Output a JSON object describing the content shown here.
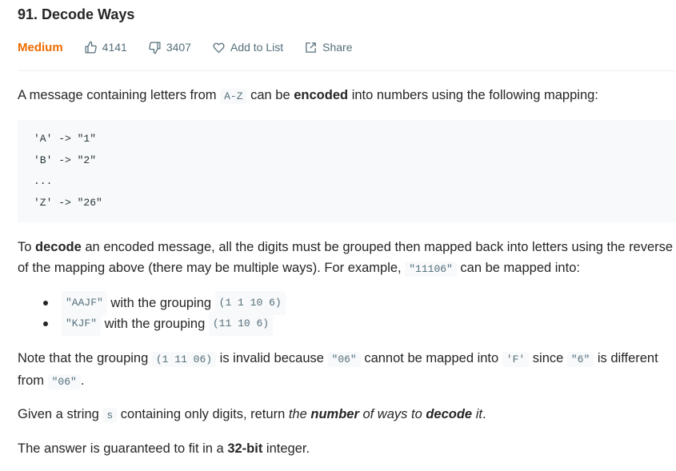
{
  "problem": {
    "title": "91. Decode Ways",
    "difficulty": "Medium",
    "likes": "4141",
    "dislikes": "3407",
    "add_to_list": "Add to List",
    "share": "Share"
  },
  "colors": {
    "difficulty": "#ef6c00",
    "meta": "#546e7a",
    "code_bg": "#f7f9fa"
  },
  "icons": [
    "thumbs-up-icon",
    "thumbs-down-icon",
    "heart-icon",
    "share-icon"
  ],
  "description": {
    "p1": {
      "a": "A message containing letters from ",
      "code": "A-Z",
      "b": " can be ",
      "bold": "encoded",
      "c": " into numbers using the following mapping:"
    },
    "mapping": [
      "'A' -> \"1\"",
      "'B' -> \"2\"",
      "...",
      "'Z' -> \"26\""
    ],
    "p2": {
      "a": "To ",
      "bold": "decode",
      "b": " an encoded message, all the digits must be grouped then mapped back into letters using the reverse of the mapping above (there may be multiple ways). For example, ",
      "code": "\"11106\"",
      "c": " can be mapped into:"
    },
    "examples": [
      {
        "code1": "\"AAJF\"",
        "text": " with the grouping ",
        "code2": "(1 1 10 6)"
      },
      {
        "code1": "\"KJF\"",
        "text": " with the grouping ",
        "code2": "(11 10 6)"
      }
    ],
    "p3": {
      "a": "Note that the grouping ",
      "code1": "(1 11 06)",
      "b": " is invalid because ",
      "code2": "\"06\"",
      "c": " cannot be mapped into ",
      "code3": "'F'",
      "d": " since ",
      "code4": "\"6\"",
      "e": " is different from ",
      "code5": "\"06\"",
      "f": "."
    },
    "p4": {
      "a": "Given a string ",
      "code": "s",
      "b": " containing only digits, return ",
      "i1": "the ",
      "bi": "number",
      "i2": " of ways to ",
      "bi2": "decode",
      "i3": " it",
      "c": "."
    },
    "p5": {
      "a": "The answer is guaranteed to fit in a ",
      "bold": "32-bit",
      "b": " integer."
    }
  }
}
